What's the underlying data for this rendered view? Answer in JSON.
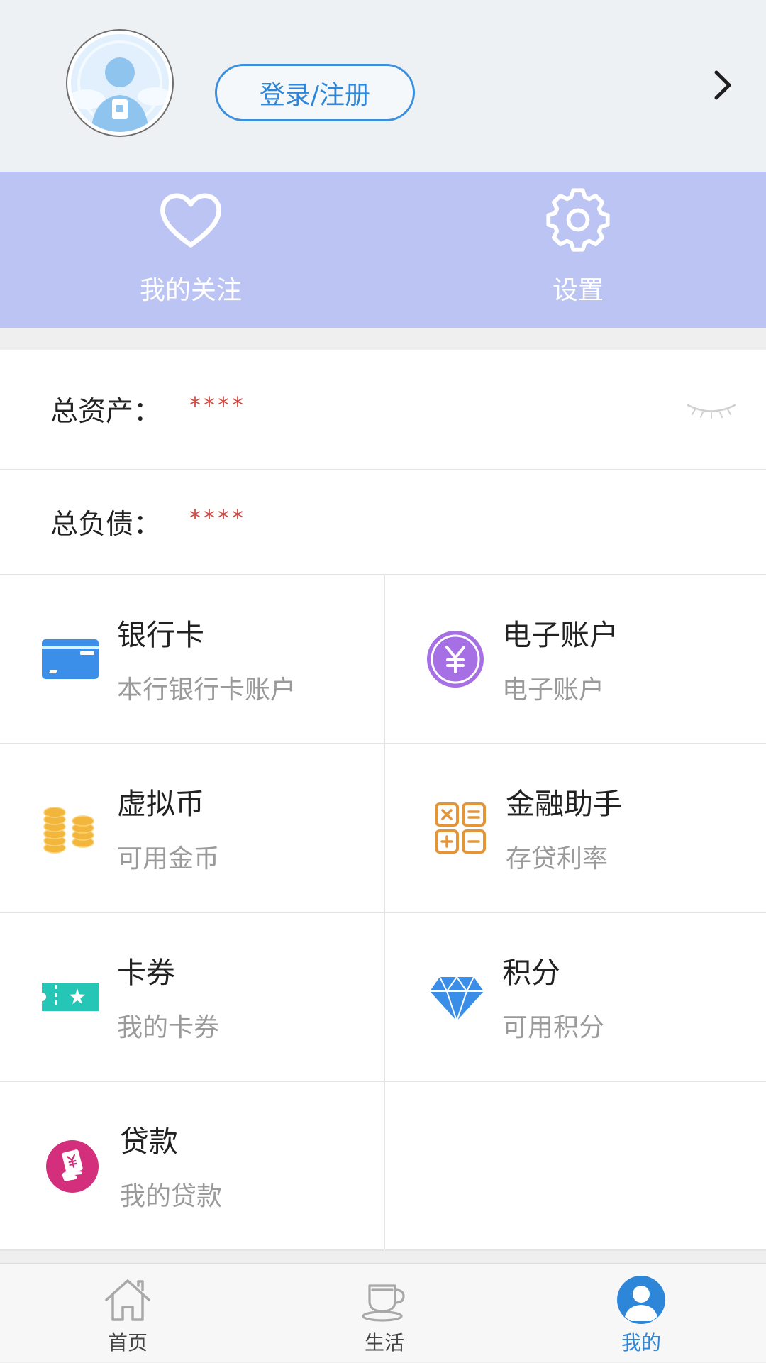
{
  "header": {
    "login_label": "登录/注册"
  },
  "quick_actions": [
    {
      "label": "我的关注",
      "icon": "heart-icon"
    },
    {
      "label": "设置",
      "icon": "gear-icon"
    }
  ],
  "assets": {
    "total_assets_label": "总资产：",
    "total_assets_value": "****",
    "total_liabilities_label": "总负债：",
    "total_liabilities_value": "****",
    "visibility_icon": "eye-closed-icon"
  },
  "grid": [
    {
      "title": "银行卡",
      "subtitle": "本行银行卡账户",
      "icon": "bank-card-icon"
    },
    {
      "title": "电子账户",
      "subtitle": "电子账户",
      "icon": "yuan-coin-icon"
    },
    {
      "title": "虚拟币",
      "subtitle": "可用金币",
      "icon": "coins-icon"
    },
    {
      "title": "金融助手",
      "subtitle": "存贷利率",
      "icon": "calculator-icon"
    },
    {
      "title": "卡券",
      "subtitle": "我的卡券",
      "icon": "ticket-icon"
    },
    {
      "title": "积分",
      "subtitle": "可用积分",
      "icon": "diamond-icon"
    },
    {
      "title": "贷款",
      "subtitle": "我的贷款",
      "icon": "loan-icon"
    }
  ],
  "tabs": [
    {
      "label": "首页",
      "icon": "home-icon",
      "active": false
    },
    {
      "label": "生活",
      "icon": "coffee-cup-icon",
      "active": false
    },
    {
      "label": "我的",
      "icon": "user-icon",
      "active": true
    }
  ],
  "colors": {
    "accent": "#2e86d9",
    "banner": "#bbc4f2",
    "masked_value": "#d34b44",
    "header_bg": "#eef1f3"
  }
}
